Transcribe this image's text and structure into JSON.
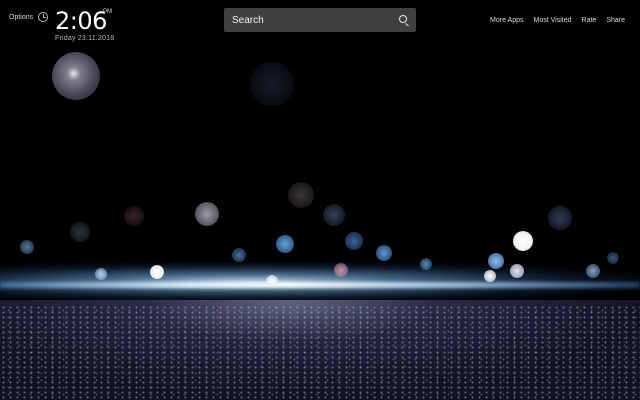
{
  "header": {
    "options_label": "Options",
    "time": "2:06",
    "ampm": "PM",
    "date": "Friday  23.11.2018"
  },
  "search": {
    "placeholder": "Search"
  },
  "nav": {
    "items": [
      {
        "label": "More Apps"
      },
      {
        "label": "Most Visited"
      },
      {
        "label": "Rate"
      },
      {
        "label": "Share"
      }
    ]
  }
}
